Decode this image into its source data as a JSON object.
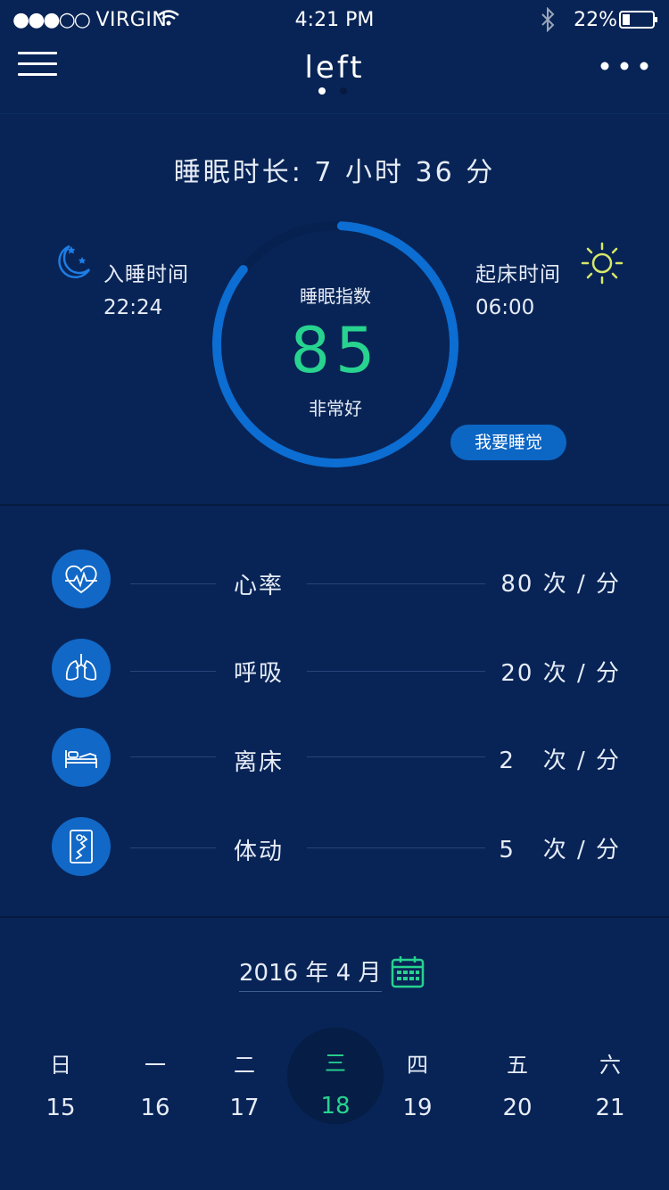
{
  "status_bar": {
    "carrier": "VIRGIN",
    "time": "4:21 PM",
    "battery": "22%",
    "bluetooth_icon": "bluetooth-icon",
    "wifi_icon": "wifi-icon"
  },
  "nav": {
    "title": "left",
    "menu_icon": "hamburger-icon",
    "more_icon": "more-dots-icon",
    "page_indicator": {
      "pages": 2,
      "active": 1
    }
  },
  "sleep": {
    "duration_text": "睡眠时长: 7 小时 36 分",
    "bedtime_label": "入睡时间",
    "bedtime_value": "22:24",
    "wake_label": "起床时间",
    "wake_value": "06:00",
    "score_title": "睡眠指数",
    "score": "85",
    "score_fraction": 0.85,
    "score_label": "非常好",
    "sleep_button": "我要睡觉"
  },
  "metrics": [
    {
      "icon": "heart-rate-icon",
      "label": "心率",
      "value": "80 次 / 分"
    },
    {
      "icon": "lungs-icon",
      "label": "呼吸",
      "value": "20 次 / 分"
    },
    {
      "icon": "bed-icon",
      "label": "离床",
      "value": "2   次 / 分"
    },
    {
      "icon": "movement-icon",
      "label": "体动",
      "value": "5   次 / 分"
    }
  ],
  "calendar": {
    "month": "2016 年 4 月",
    "weekdays": [
      "日",
      "一",
      "二",
      "三",
      "四",
      "五",
      "六"
    ],
    "dates": [
      "15",
      "16",
      "17",
      "18",
      "19",
      "20",
      "21"
    ],
    "selected_index": 3
  },
  "colors": {
    "background": "#082456",
    "accent": "#1168c6",
    "score_green": "#27d38f",
    "sun_yellow": "#d7e86a"
  }
}
